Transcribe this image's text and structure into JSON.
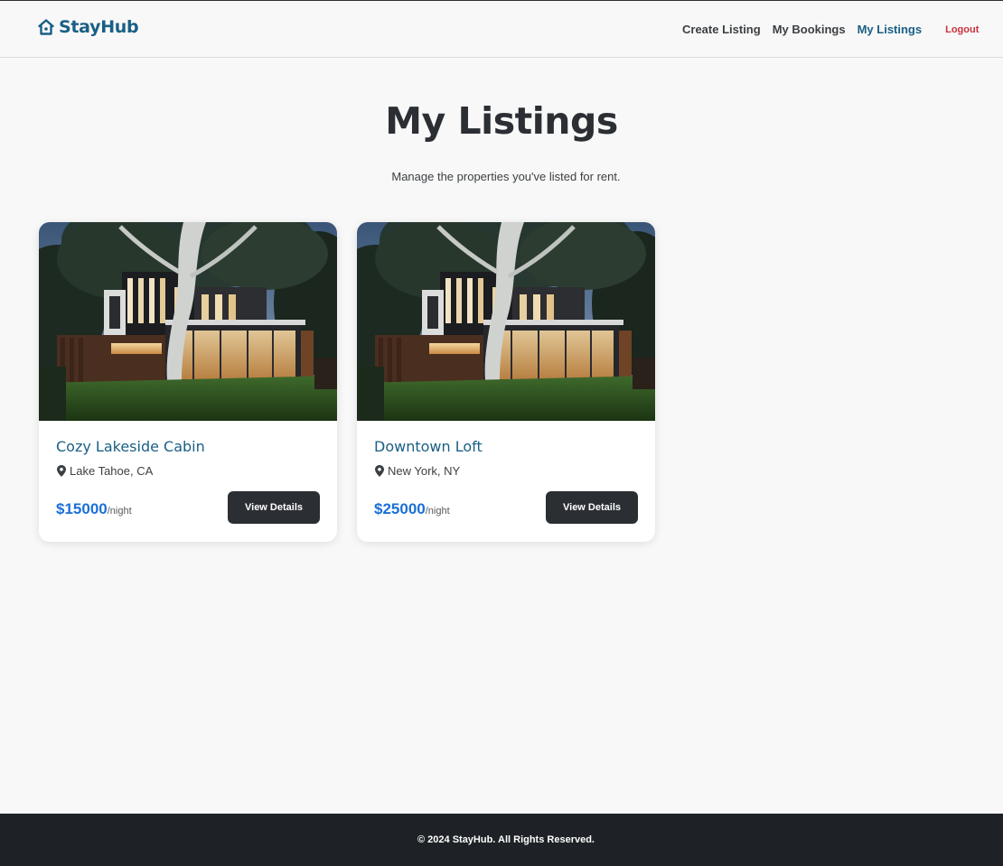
{
  "brand": {
    "name": "StayHub",
    "icon": "house-icon",
    "color": "#1a5f85"
  },
  "nav": {
    "items": [
      {
        "label": "Create Listing",
        "active": false
      },
      {
        "label": "My Bookings",
        "active": false
      },
      {
        "label": "My Listings",
        "active": true
      }
    ],
    "logout_label": "Logout"
  },
  "page": {
    "title": "My Listings",
    "subtitle": "Manage the properties you've listed for rent."
  },
  "listings": [
    {
      "title": "Cozy Lakeside Cabin",
      "location": "Lake Tahoe, CA",
      "price": "$15000",
      "unit": "/night",
      "button_label": "View Details",
      "image": "modern-house-photo"
    },
    {
      "title": "Downtown Loft",
      "location": "New York, NY",
      "price": "$25000",
      "unit": "/night",
      "button_label": "View Details",
      "image": "modern-house-photo"
    }
  ],
  "footer": {
    "text": "© 2024 StayHub. All Rights Reserved."
  },
  "colors": {
    "accent": "#1a5f85",
    "price": "#1b6fd6",
    "logout": "#c8323c",
    "dark": "#2b2f33",
    "footer_bg": "#1e2226"
  }
}
